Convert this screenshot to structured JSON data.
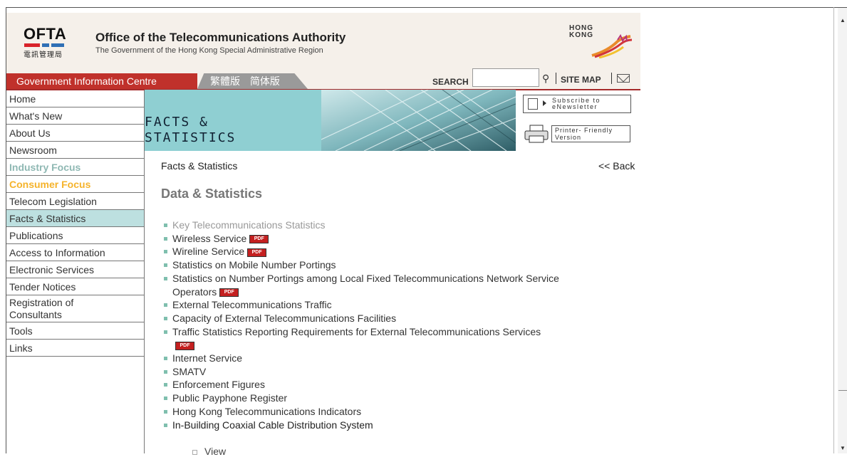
{
  "header": {
    "logo_text": "OFTA",
    "logo_chinese": "電訊管理局",
    "org_title": "Office of the Telecommunications Authority",
    "org_subtitle": "The Government of the Hong Kong Special Administrative Region",
    "hk_logo_line1": "HONG",
    "hk_logo_line2": "KONG"
  },
  "topbar": {
    "gic_label": "Government Information Centre",
    "lang_traditional": "繁體版",
    "lang_simplified": "简体版",
    "search_label": "SEARCH",
    "search_value": "",
    "sitemap_label": "SITE MAP"
  },
  "sidebar": {
    "items": [
      {
        "label": "Home"
      },
      {
        "label": "What's New"
      },
      {
        "label": "About Us"
      },
      {
        "label": "Newsroom"
      },
      {
        "label": "Industry Focus"
      },
      {
        "label": "Consumer Focus"
      },
      {
        "label": "Telecom Legislation"
      },
      {
        "label": "Facts & Statistics"
      },
      {
        "label": "Publications"
      },
      {
        "label": "Access to Information"
      },
      {
        "label": "Electronic Services"
      },
      {
        "label": "Tender Notices"
      },
      {
        "label": "Registration of Consultants"
      },
      {
        "label": "Tools"
      },
      {
        "label": "Links"
      }
    ]
  },
  "banner": {
    "title_line1": "FACTS &",
    "title_line2": "STATISTICS",
    "subscribe_line1": "Subscribe to",
    "subscribe_line2": "eNewsletter",
    "printer_line1": "Printer- Friendly",
    "printer_line2": "Version"
  },
  "content": {
    "breadcrumb": "Facts & Statistics",
    "back_label": "<< Back",
    "page_title": "Data & Statistics",
    "pdf_badge": "PDF",
    "links": [
      {
        "label": "Key Telecommunications Statistics"
      },
      {
        "label": "Wireless Service"
      },
      {
        "label": "Wireline Service"
      },
      {
        "label": "Statistics on Mobile Number Portings"
      },
      {
        "label": "Statistics on Number Portings among Local Fixed Telecommunications Network Service Operators"
      },
      {
        "label": "External Telecommunications Traffic"
      },
      {
        "label": "Capacity of External Telecommunications Facilities"
      },
      {
        "label": "Traffic Statistics Reporting Requirements for External Telecommunications Services"
      },
      {
        "label": "Internet Service"
      },
      {
        "label": "SMATV"
      },
      {
        "label": "Enforcement Figures"
      },
      {
        "label": "Public Payphone Register"
      },
      {
        "label": "Hong Kong Telecommunications Indicators"
      },
      {
        "label": "In-Building Coaxial Cable Distribution System"
      }
    ],
    "sub_link": "View"
  },
  "colors": {
    "accent_red": "#c0312b",
    "active_teal": "#bde0e0",
    "banner_teal": "#8fcfd2",
    "industry_focus": "#8fb8b3",
    "consumer_focus": "#f5b32b"
  }
}
